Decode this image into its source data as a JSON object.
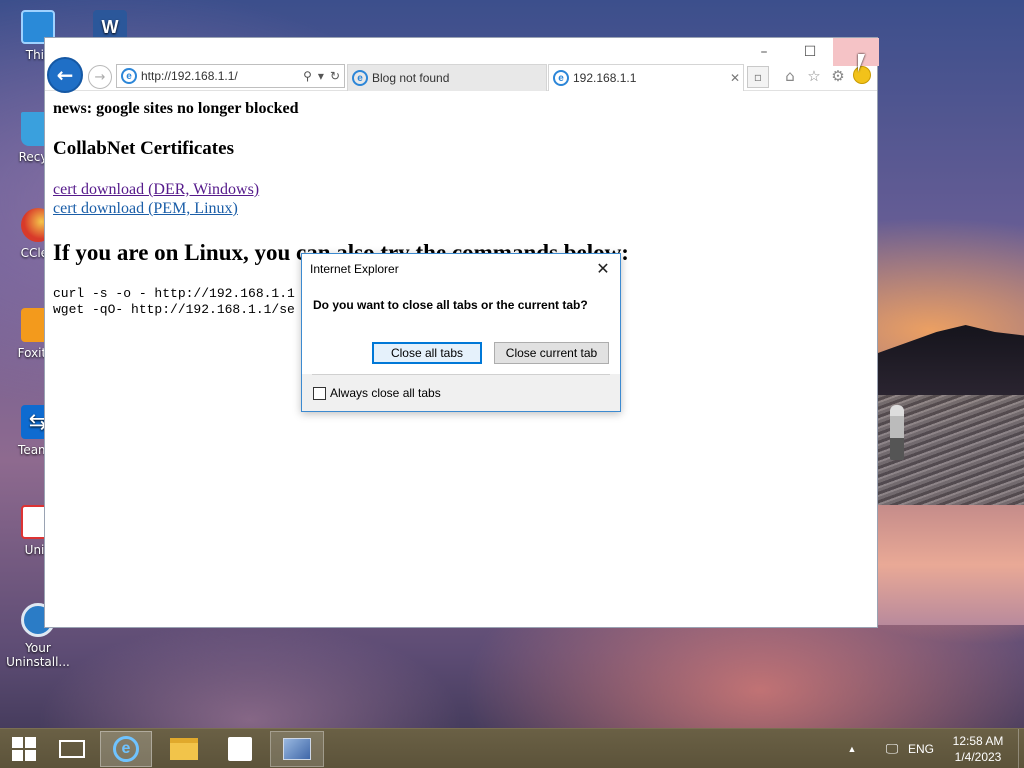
{
  "desktop": {
    "icons": [
      {
        "label": "This",
        "icon": "monitor-icon",
        "color": "#2a8ad8"
      },
      {
        "label": "Recycl",
        "icon": "recycle-bin-icon",
        "color": "#3aa0dd"
      },
      {
        "label": "CClea",
        "icon": "ccleaner-icon",
        "color": "#d83a2a"
      },
      {
        "label": "Foxit R",
        "icon": "foxit-reader-icon",
        "color": "#f39a1c"
      },
      {
        "label": "TeamV",
        "icon": "teamviewer-icon",
        "color": "#0e6bd0"
      },
      {
        "label": "Unik",
        "icon": "uniko-icon",
        "color": "#ffffff"
      },
      {
        "label": "Your Uninstall...",
        "icon": "your-uninstaller-icon",
        "color": "#2b7cc6"
      }
    ],
    "top_icon": {
      "label": "W",
      "icon": "word-icon"
    }
  },
  "browser": {
    "address": "http://192.168.1.1/",
    "tabs": [
      {
        "label": "Blog not found"
      },
      {
        "label": "192.168.1.1"
      }
    ],
    "window_controls": {
      "minimize": "–",
      "maximize": "☐",
      "close": ""
    }
  },
  "page": {
    "news": "news: google sites no longer blocked",
    "certs_heading": "CollabNet Certificates",
    "link_der": "cert download (DER, Windows)",
    "link_pem": "cert download (PEM, Linux)",
    "linux_heading": "If you are on Linux, you can also try the commands below:",
    "cmd_curl": "curl -s -o - http://192.168.1.1",
    "cmd_wget": "wget -qO- http://192.168.1.1/se"
  },
  "dialog": {
    "title": "Internet Explorer",
    "question": "Do you want to close all tabs or the current tab?",
    "close_all": "Close all tabs",
    "close_current": "Close current tab",
    "always_close": "Always close all tabs",
    "always_checked": false
  },
  "taskbar": {
    "language": "ENG",
    "time": "12:58 AM",
    "date": "1/4/2023"
  },
  "colors": {
    "accent": "#0078d7",
    "link_visited": "#551a8b",
    "link": "#1b5ea8"
  }
}
